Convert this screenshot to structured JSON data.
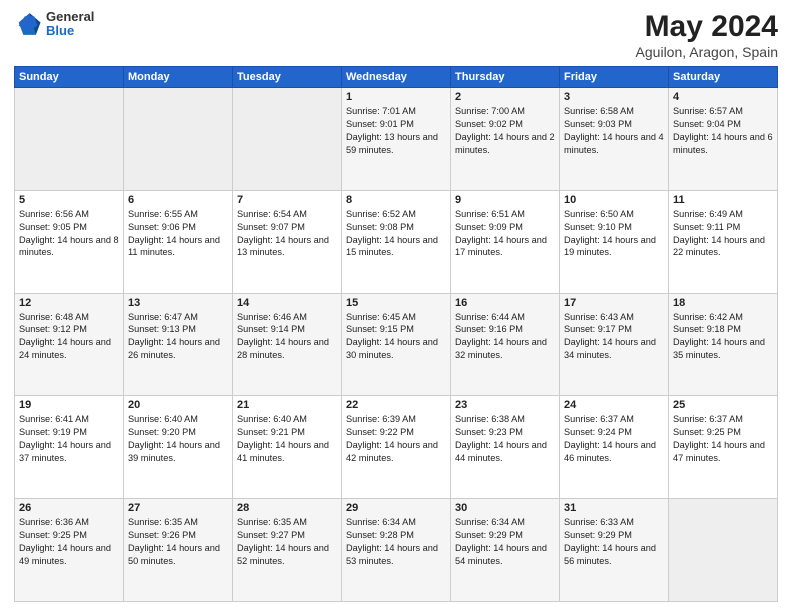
{
  "header": {
    "logo_general": "General",
    "logo_blue": "Blue",
    "title": "May 2024",
    "location": "Aguilon, Aragon, Spain"
  },
  "days_of_week": [
    "Sunday",
    "Monday",
    "Tuesday",
    "Wednesday",
    "Thursday",
    "Friday",
    "Saturday"
  ],
  "weeks": [
    [
      {
        "num": "",
        "empty": true
      },
      {
        "num": "",
        "empty": true
      },
      {
        "num": "",
        "empty": true
      },
      {
        "num": "1",
        "sunrise": "7:01 AM",
        "sunset": "9:01 PM",
        "daylight": "13 hours and 59 minutes."
      },
      {
        "num": "2",
        "sunrise": "7:00 AM",
        "sunset": "9:02 PM",
        "daylight": "14 hours and 2 minutes."
      },
      {
        "num": "3",
        "sunrise": "6:58 AM",
        "sunset": "9:03 PM",
        "daylight": "14 hours and 4 minutes."
      },
      {
        "num": "4",
        "sunrise": "6:57 AM",
        "sunset": "9:04 PM",
        "daylight": "14 hours and 6 minutes."
      }
    ],
    [
      {
        "num": "5",
        "sunrise": "6:56 AM",
        "sunset": "9:05 PM",
        "daylight": "14 hours and 8 minutes."
      },
      {
        "num": "6",
        "sunrise": "6:55 AM",
        "sunset": "9:06 PM",
        "daylight": "14 hours and 11 minutes."
      },
      {
        "num": "7",
        "sunrise": "6:54 AM",
        "sunset": "9:07 PM",
        "daylight": "14 hours and 13 minutes."
      },
      {
        "num": "8",
        "sunrise": "6:52 AM",
        "sunset": "9:08 PM",
        "daylight": "14 hours and 15 minutes."
      },
      {
        "num": "9",
        "sunrise": "6:51 AM",
        "sunset": "9:09 PM",
        "daylight": "14 hours and 17 minutes."
      },
      {
        "num": "10",
        "sunrise": "6:50 AM",
        "sunset": "9:10 PM",
        "daylight": "14 hours and 19 minutes."
      },
      {
        "num": "11",
        "sunrise": "6:49 AM",
        "sunset": "9:11 PM",
        "daylight": "14 hours and 22 minutes."
      }
    ],
    [
      {
        "num": "12",
        "sunrise": "6:48 AM",
        "sunset": "9:12 PM",
        "daylight": "14 hours and 24 minutes."
      },
      {
        "num": "13",
        "sunrise": "6:47 AM",
        "sunset": "9:13 PM",
        "daylight": "14 hours and 26 minutes."
      },
      {
        "num": "14",
        "sunrise": "6:46 AM",
        "sunset": "9:14 PM",
        "daylight": "14 hours and 28 minutes."
      },
      {
        "num": "15",
        "sunrise": "6:45 AM",
        "sunset": "9:15 PM",
        "daylight": "14 hours and 30 minutes."
      },
      {
        "num": "16",
        "sunrise": "6:44 AM",
        "sunset": "9:16 PM",
        "daylight": "14 hours and 32 minutes."
      },
      {
        "num": "17",
        "sunrise": "6:43 AM",
        "sunset": "9:17 PM",
        "daylight": "14 hours and 34 minutes."
      },
      {
        "num": "18",
        "sunrise": "6:42 AM",
        "sunset": "9:18 PM",
        "daylight": "14 hours and 35 minutes."
      }
    ],
    [
      {
        "num": "19",
        "sunrise": "6:41 AM",
        "sunset": "9:19 PM",
        "daylight": "14 hours and 37 minutes."
      },
      {
        "num": "20",
        "sunrise": "6:40 AM",
        "sunset": "9:20 PM",
        "daylight": "14 hours and 39 minutes."
      },
      {
        "num": "21",
        "sunrise": "6:40 AM",
        "sunset": "9:21 PM",
        "daylight": "14 hours and 41 minutes."
      },
      {
        "num": "22",
        "sunrise": "6:39 AM",
        "sunset": "9:22 PM",
        "daylight": "14 hours and 42 minutes."
      },
      {
        "num": "23",
        "sunrise": "6:38 AM",
        "sunset": "9:23 PM",
        "daylight": "14 hours and 44 minutes."
      },
      {
        "num": "24",
        "sunrise": "6:37 AM",
        "sunset": "9:24 PM",
        "daylight": "14 hours and 46 minutes."
      },
      {
        "num": "25",
        "sunrise": "6:37 AM",
        "sunset": "9:25 PM",
        "daylight": "14 hours and 47 minutes."
      }
    ],
    [
      {
        "num": "26",
        "sunrise": "6:36 AM",
        "sunset": "9:25 PM",
        "daylight": "14 hours and 49 minutes."
      },
      {
        "num": "27",
        "sunrise": "6:35 AM",
        "sunset": "9:26 PM",
        "daylight": "14 hours and 50 minutes."
      },
      {
        "num": "28",
        "sunrise": "6:35 AM",
        "sunset": "9:27 PM",
        "daylight": "14 hours and 52 minutes."
      },
      {
        "num": "29",
        "sunrise": "6:34 AM",
        "sunset": "9:28 PM",
        "daylight": "14 hours and 53 minutes."
      },
      {
        "num": "30",
        "sunrise": "6:34 AM",
        "sunset": "9:29 PM",
        "daylight": "14 hours and 54 minutes."
      },
      {
        "num": "31",
        "sunrise": "6:33 AM",
        "sunset": "9:29 PM",
        "daylight": "14 hours and 56 minutes."
      },
      {
        "num": "",
        "empty": true
      }
    ]
  ]
}
